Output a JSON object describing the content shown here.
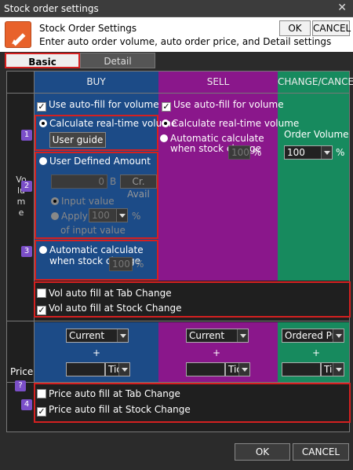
{
  "window": {
    "title": "Stock order settings",
    "close": "✕"
  },
  "header": {
    "title": "Stock Order Settings",
    "subtitle": "Enter auto order volume, auto order price, and Detail settings",
    "ok": "OK",
    "cancel": "CANCEL"
  },
  "tabs": {
    "basic": "Basic",
    "detail": "Detail"
  },
  "columns": {
    "buy": "BUY",
    "sell": "SELL",
    "change": "CHANGE/CANCEL"
  },
  "volume": {
    "label": "Volume",
    "buy": {
      "autofill": "Use auto-fill for volume",
      "realtime": "Calculate real-time volume",
      "user_guide": "User guide",
      "user_defined": "User Defined Amount",
      "amount": "0",
      "amount_unit": "B",
      "cr_avail": "Cr. Avail",
      "input_value": "Input value",
      "apply": "Apply",
      "apply_value": "100",
      "pct": "%",
      "of_input": "of input value",
      "auto_calc": "Automatic calculate when stock change",
      "auto_value": "100",
      "auto_pct": "%"
    },
    "sell": {
      "autofill": "Use auto-fill for volume",
      "realtime": "Calculate real-time volume",
      "auto_calc": "Automatic calculate when stock change",
      "auto_value": "100",
      "auto_pct": "%"
    },
    "change": {
      "order_volume": "Order Volume",
      "value": "100",
      "pct": "%"
    },
    "tab_change": "Vol auto fill at Tab Change",
    "stock_change": "Vol auto fill at Stock Change"
  },
  "price": {
    "label": "Price",
    "help": "?",
    "buy": {
      "type": "Current",
      "plus": "+",
      "tick": "Tic"
    },
    "sell": {
      "type": "Current",
      "plus": "+",
      "tick": "Tic"
    },
    "change": {
      "type": "Ordered Pric",
      "plus": "+",
      "tick": "Tic"
    },
    "tab_change": "Price auto fill at Tab Change",
    "stock_change": "Price auto fill at Stock Change"
  },
  "markers": [
    "1",
    "2",
    "3",
    "4"
  ],
  "footer": {
    "ok": "OK",
    "cancel": "CANCEL"
  }
}
